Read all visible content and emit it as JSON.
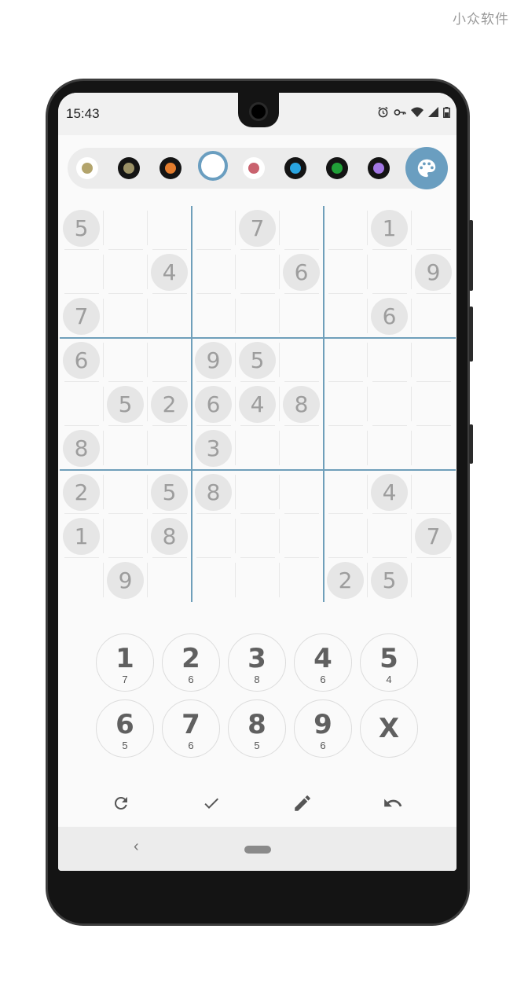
{
  "watermark": "小众软件",
  "status": {
    "time": "15:43",
    "icons": [
      "alarm-icon",
      "vpn-key-icon",
      "wifi-icon",
      "signal-icon",
      "battery-icon"
    ]
  },
  "palette": {
    "swatches": [
      {
        "name": "tan",
        "color": "#b3a46c"
      },
      {
        "name": "olive",
        "color": "#9b9166"
      },
      {
        "name": "orange",
        "color": "#e37c2d"
      },
      {
        "name": "white",
        "color": "#ffffff",
        "selected": true
      },
      {
        "name": "rose",
        "color": "#c9626e"
      },
      {
        "name": "blue",
        "color": "#29a4e0"
      },
      {
        "name": "green",
        "color": "#21a038"
      },
      {
        "name": "purple",
        "color": "#a277e3"
      }
    ],
    "button_icon": "palette-icon",
    "accent": "#6a9ec0"
  },
  "grid": {
    "rows": [
      [
        "5",
        "",
        "",
        "",
        "7",
        "",
        "",
        "1",
        ""
      ],
      [
        "",
        "",
        "4",
        "",
        "",
        "6",
        "",
        "",
        "9"
      ],
      [
        "7",
        "",
        "",
        "",
        "",
        "",
        "",
        "6",
        ""
      ],
      [
        "6",
        "",
        "",
        "9",
        "5",
        "",
        "",
        "",
        ""
      ],
      [
        "",
        "5",
        "2",
        "6",
        "4",
        "8",
        "",
        "",
        ""
      ],
      [
        "8",
        "",
        "",
        "3",
        "",
        "",
        "",
        "",
        ""
      ],
      [
        "2",
        "",
        "5",
        "8",
        "",
        "",
        "",
        "4",
        ""
      ],
      [
        "1",
        "",
        "8",
        "",
        "",
        "",
        "",
        "",
        "7"
      ],
      [
        "",
        "9",
        "",
        "",
        "",
        "",
        "2",
        "5",
        ""
      ]
    ]
  },
  "keypad": [
    {
      "label": "1",
      "count": "7"
    },
    {
      "label": "2",
      "count": "6"
    },
    {
      "label": "3",
      "count": "8"
    },
    {
      "label": "4",
      "count": "6"
    },
    {
      "label": "5",
      "count": "4"
    },
    {
      "label": "6",
      "count": "5"
    },
    {
      "label": "7",
      "count": "6"
    },
    {
      "label": "8",
      "count": "5"
    },
    {
      "label": "9",
      "count": "6"
    },
    {
      "label": "X",
      "count": ""
    }
  ],
  "actions": [
    "refresh-icon",
    "check-icon",
    "pencil-icon",
    "undo-icon"
  ]
}
